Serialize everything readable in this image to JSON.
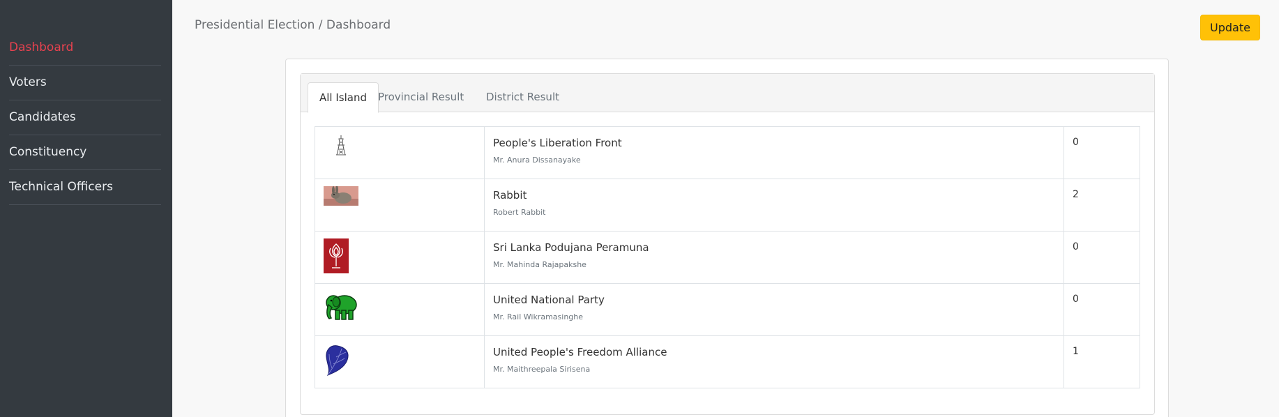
{
  "sidebar": {
    "items": [
      {
        "label": "Dashboard"
      },
      {
        "label": "Voters"
      },
      {
        "label": "Candidates"
      },
      {
        "label": "Constituency"
      },
      {
        "label": "Technical Officers"
      }
    ]
  },
  "header": {
    "breadcrumb": "Presidential Election / Dashboard",
    "update_label": "Update"
  },
  "tabs": [
    {
      "label": "All Island"
    },
    {
      "label": "Provincial Result"
    },
    {
      "label": "District Result"
    }
  ],
  "results": [
    {
      "party": "People's Liberation Front",
      "candidate": "Mr. Anura Dissanayake",
      "votes": "0",
      "icon": "bell-tower-logo"
    },
    {
      "party": "Rabbit",
      "candidate": "Robert Rabbit",
      "votes": "2",
      "icon": "rabbit-photo"
    },
    {
      "party": "Sri Lanka Podujana Peramuna",
      "candidate": "Mr. Mahinda Rajapakshe",
      "votes": "0",
      "icon": "lotus-bud-logo"
    },
    {
      "party": "United National Party",
      "candidate": "Mr. Rail Wikramasinghe",
      "votes": "0",
      "icon": "elephant-logo"
    },
    {
      "party": "United People's Freedom Alliance",
      "candidate": "Mr. Maithreepala Sirisena",
      "votes": "1",
      "icon": "betel-leaf-logo"
    }
  ],
  "colors": {
    "sidebar_bg": "#343a40",
    "active_link": "#e8424f",
    "update_button": "#ffc107"
  }
}
